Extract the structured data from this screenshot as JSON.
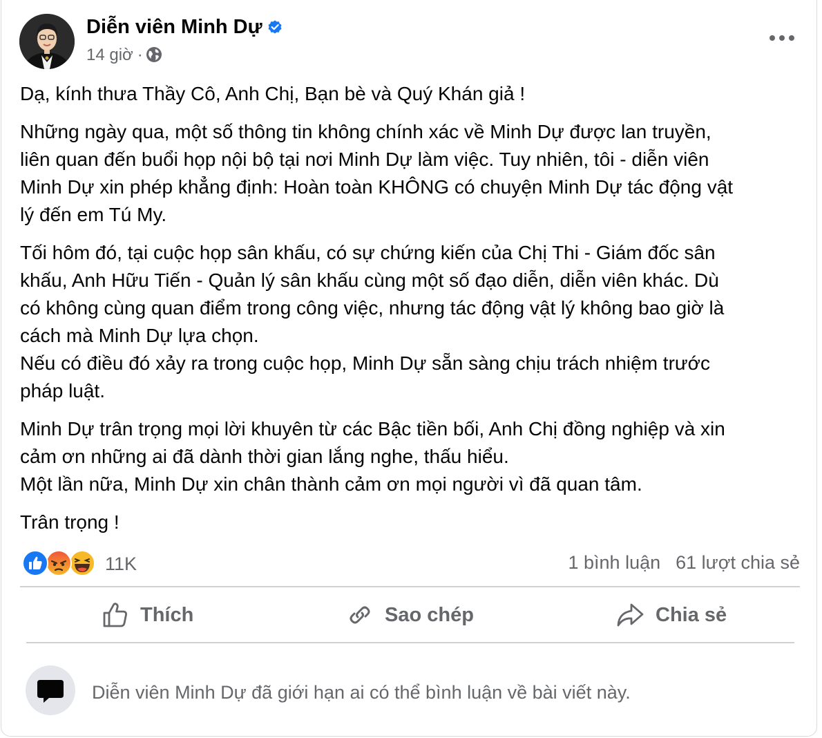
{
  "post": {
    "author_name": "Diễn viên Minh Dự",
    "time": "14 giờ",
    "separator": "·",
    "verified_icon": "verified-badge-icon",
    "privacy_icon": "globe-icon",
    "paragraphs": [
      [
        "Dạ, kính thưa Thầy Cô, Anh Chị, Bạn bè và Quý Khán giả !"
      ],
      [
        "Những ngày qua, một số thông tin không chính xác về Minh Dự được lan truyền,",
        "liên quan đến buổi họp nội bộ tại nơi Minh Dự làm việc. Tuy nhiên, tôi - diễn viên",
        "Minh Dự xin phép khẳng định: Hoàn toàn KHÔNG có chuyện Minh Dự tác động vật",
        "lý đến em Tú My."
      ],
      [
        "Tối hôm đó, tại cuộc họp sân khấu, có sự chứng kiến của Chị Thi - Giám đốc sân",
        "khấu, Anh Hữu Tiến - Quản lý sân khấu cùng một số đạo diễn, diễn viên khác. Dù",
        "có không cùng quan điểm trong công việc, nhưng tác động vật lý không bao giờ là",
        "cách mà Minh Dự lựa chọn.",
        "Nếu có điều đó xảy ra trong cuộc họp, Minh Dự sẵn sàng chịu trách nhiệm trước",
        "pháp luật."
      ],
      [
        "Minh Dự trân trọng mọi lời khuyên từ các Bậc tiền bối, Anh Chị đồng nghiệp và xin",
        "cảm ơn những ai đã dành thời gian lắng nghe, thấu hiểu.",
        "Một lần nữa, Minh Dự xin chân thành cảm ơn mọi người vì đã quan tâm."
      ],
      [
        "Trân trọng !"
      ]
    ]
  },
  "stats": {
    "reaction_icons": [
      "like-reaction-icon",
      "angry-reaction-icon",
      "haha-reaction-icon"
    ],
    "reaction_count": "11K",
    "comments": "1 bình luận",
    "shares": "61 lượt chia sẻ"
  },
  "actions": {
    "like": "Thích",
    "copy": "Sao chép",
    "share": "Chia sẻ"
  },
  "comment_notice": "Diễn viên Minh Dự đã giới hạn ai có thể bình luận về bài viết này.",
  "colors": {
    "facebook_blue": "#1877f2",
    "secondary_text": "#65676b",
    "divider": "#ced0d4",
    "angry_orange": "#f0543b",
    "haha_yellow": "#f7b928"
  }
}
